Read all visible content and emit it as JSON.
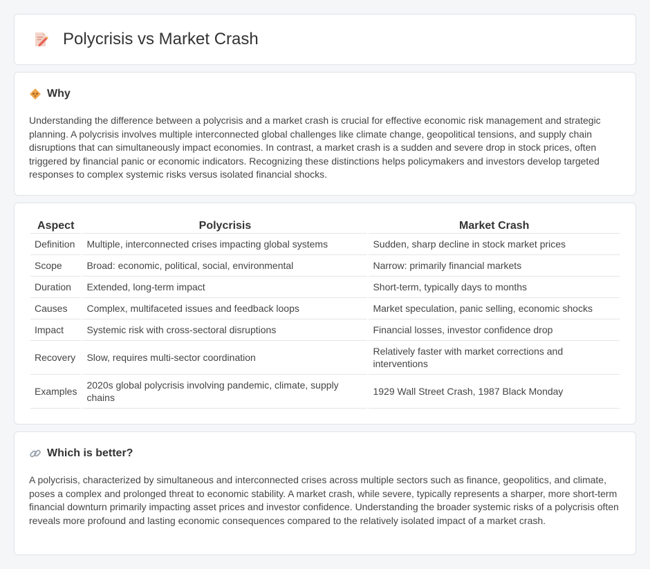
{
  "header": {
    "title": "Polycrisis vs Market Crash",
    "icon": "document-pencil-icon"
  },
  "why": {
    "title": "Why",
    "icon": "diamond-warning-icon",
    "body": "Understanding the difference between a polycrisis and a market crash is crucial for effective economic risk management and strategic planning. A polycrisis involves multiple interconnected global challenges like climate change, geopolitical tensions, and supply chain disruptions that can simultaneously impact economies. In contrast, a market crash is a sudden and severe drop in stock prices, often triggered by financial panic or economic indicators. Recognizing these distinctions helps policymakers and investors develop targeted responses to complex systemic risks versus isolated financial shocks."
  },
  "table": {
    "headers": [
      "Aspect",
      "Polycrisis",
      "Market Crash"
    ],
    "rows": [
      {
        "aspect": "Definition",
        "polycrisis": "Multiple, interconnected crises impacting global systems",
        "market_crash": "Sudden, sharp decline in stock market prices"
      },
      {
        "aspect": "Scope",
        "polycrisis": "Broad: economic, political, social, environmental",
        "market_crash": "Narrow: primarily financial markets"
      },
      {
        "aspect": "Duration",
        "polycrisis": "Extended, long-term impact",
        "market_crash": "Short-term, typically days to months"
      },
      {
        "aspect": "Causes",
        "polycrisis": "Complex, multifaceted issues and feedback loops",
        "market_crash": "Market speculation, panic selling, economic shocks"
      },
      {
        "aspect": "Impact",
        "polycrisis": "Systemic risk with cross-sectoral disruptions",
        "market_crash": "Financial losses, investor confidence drop"
      },
      {
        "aspect": "Recovery",
        "polycrisis": "Slow, requires multi-sector coordination",
        "market_crash": "Relatively faster with market corrections and interventions"
      },
      {
        "aspect": "Examples",
        "polycrisis": "2020s global polycrisis involving pandemic, climate, supply chains",
        "market_crash": "1929 Wall Street Crash, 1987 Black Monday"
      }
    ]
  },
  "better": {
    "title": "Which is better?",
    "icon": "link-icon",
    "body": "A polycrisis, characterized by simultaneous and interconnected crises across multiple sectors such as finance, geopolitics, and climate, poses a complex and prolonged threat to economic stability. A market crash, while severe, typically represents a sharper, more short-term financial downturn primarily impacting asset prices and investor confidence. Understanding the broader systemic risks of a polycrisis often reveals more profound and lasting economic consequences compared to the relatively isolated impact of a market crash."
  },
  "colors": {
    "background": "#f4f6f8",
    "card": "#ffffff",
    "border": "#e1e4e8",
    "icon_orange": "#f0a54a",
    "icon_red": "#e8665a"
  }
}
